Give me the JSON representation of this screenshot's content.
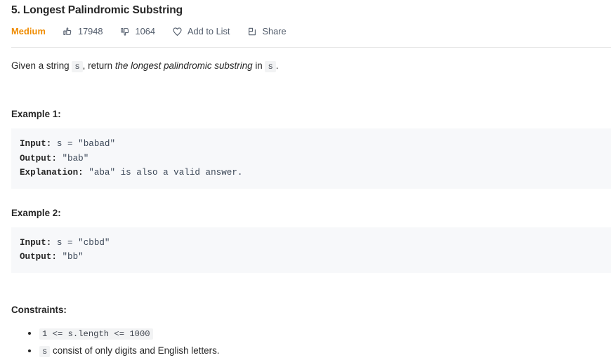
{
  "problem": {
    "title": "5. Longest Palindromic Substring",
    "difficulty": "Medium"
  },
  "meta": {
    "likes": {
      "icon": "thumbs-up-icon",
      "count": "17948"
    },
    "dislikes": {
      "icon": "thumbs-down-icon",
      "count": "1064"
    },
    "add_to_list": {
      "icon": "heart-icon",
      "label": "Add to List"
    },
    "share": {
      "icon": "share-icon",
      "label": "Share"
    }
  },
  "description": {
    "part1": "Given a string ",
    "code1": "s",
    "part2": ", return ",
    "emphasis": "the longest palindromic substring",
    "part3": " in ",
    "code2": "s",
    "part4": "."
  },
  "examples": [
    {
      "heading": "Example 1:",
      "lines": [
        {
          "label": "Input:",
          "value": " s = \"babad\""
        },
        {
          "label": "Output:",
          "value": " \"bab\""
        },
        {
          "label": "Explanation:",
          "value": " \"aba\" is also a valid answer."
        }
      ]
    },
    {
      "heading": "Example 2:",
      "lines": [
        {
          "label": "Input:",
          "value": " s = \"cbbd\""
        },
        {
          "label": "Output:",
          "value": " \"bb\""
        }
      ]
    }
  ],
  "constraints": {
    "heading": "Constraints:",
    "items": [
      {
        "code": "1 <= s.length <= 1000",
        "text": ""
      },
      {
        "code": "s",
        "text": " consist of only digits and English letters."
      }
    ]
  },
  "colors": {
    "difficulty_medium": "#ef8b00",
    "meta_text": "#525c6b",
    "title_text": "#262626",
    "codeblock_bg": "#f7f8fa",
    "inline_code_bg": "#f2f3f4",
    "divider": "#e6e6e6"
  }
}
